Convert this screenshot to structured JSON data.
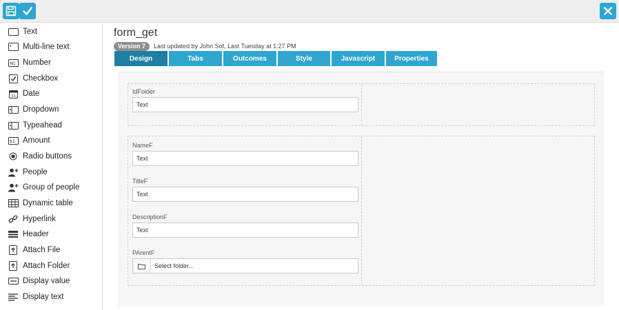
{
  "toolbar": {
    "save_icon": "floppy-disk-icon",
    "confirm_icon": "checkmark-icon",
    "close_icon": "close-icon",
    "accent": "#2ea6cf"
  },
  "sidebar": {
    "items": [
      {
        "label": "Text",
        "icon": "text-field-icon"
      },
      {
        "label": "Multi-line text",
        "icon": "multiline-text-icon"
      },
      {
        "label": "Number",
        "icon": "number-icon"
      },
      {
        "label": "Checkbox",
        "icon": "checkbox-icon"
      },
      {
        "label": "Date",
        "icon": "calendar-icon"
      },
      {
        "label": "Dropdown",
        "icon": "dropdown-icon"
      },
      {
        "label": "Typeahead",
        "icon": "typeahead-icon"
      },
      {
        "label": "Amount",
        "icon": "amount-icon"
      },
      {
        "label": "Radio buttons",
        "icon": "radio-icon"
      },
      {
        "label": "People",
        "icon": "person-add-icon"
      },
      {
        "label": "Group of people",
        "icon": "group-add-icon"
      },
      {
        "label": "Dynamic table",
        "icon": "table-icon"
      },
      {
        "label": "Hyperlink",
        "icon": "link-icon"
      },
      {
        "label": "Header",
        "icon": "header-icon"
      },
      {
        "label": "Attach File",
        "icon": "attach-file-icon"
      },
      {
        "label": "Attach Folder",
        "icon": "attach-folder-icon"
      },
      {
        "label": "Display value",
        "icon": "display-value-icon"
      },
      {
        "label": "Display text",
        "icon": "display-text-icon"
      }
    ]
  },
  "form": {
    "title": "form_get",
    "version": "Version 7",
    "updated": "Last updated by John Sot, Last Tuesday at 1:27 PM"
  },
  "tabs": [
    {
      "label": "Design",
      "active": true
    },
    {
      "label": "Tabs",
      "active": false
    },
    {
      "label": "Outcomes",
      "active": false
    },
    {
      "label": "Style",
      "active": false
    },
    {
      "label": "Javascript",
      "active": false
    },
    {
      "label": "Properties",
      "active": false
    }
  ],
  "fields": {
    "idfolder": {
      "label": "IdFolder",
      "value": "Text"
    },
    "namef": {
      "label": "NameF",
      "value": "Text"
    },
    "titlef": {
      "label": "TitleF",
      "value": "Text"
    },
    "descriptionf": {
      "label": "DescriptionF",
      "value": "Text"
    },
    "parentf": {
      "label": "PArentF",
      "placeholder": "Select folder...",
      "icon": "folder-icon"
    }
  }
}
